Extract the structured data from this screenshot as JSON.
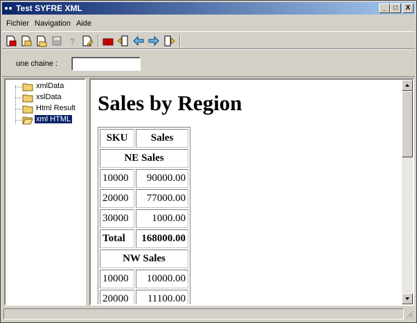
{
  "window": {
    "title": "Test SYFRE XML",
    "controls": {
      "minimize": "_",
      "maximize": "□",
      "close": "X"
    }
  },
  "menu": [
    {
      "label": "Fichier"
    },
    {
      "label": "Navigation"
    },
    {
      "label": "Aide"
    }
  ],
  "toolbar": {
    "buttons": [
      "new-doc-icon",
      "open-doc-icon",
      "open-folder-doc-icon",
      "save-icon",
      "help-icon",
      "edit-doc-icon",
      "books-icon",
      "back-doc-icon",
      "back-arrow-icon",
      "forward-arrow-icon",
      "forward-doc-icon"
    ]
  },
  "input_bar": {
    "label": "une chaine :",
    "value": ""
  },
  "tree": {
    "items": [
      {
        "label": "xmlData",
        "selected": false
      },
      {
        "label": "xslData",
        "selected": false
      },
      {
        "label": "Html Result",
        "selected": false
      },
      {
        "label": "xml HTML",
        "selected": true
      }
    ]
  },
  "report": {
    "title": "Sales by Region",
    "headers": {
      "sku": "SKU",
      "sales": "Sales"
    },
    "groups": [
      {
        "name": "NE Sales",
        "rows": [
          {
            "sku": "10000",
            "sales": "90000.00"
          },
          {
            "sku": "20000",
            "sales": "77000.00"
          },
          {
            "sku": "30000",
            "sales": "1000.00"
          }
        ],
        "total_label": "Total",
        "total": "168000.00"
      },
      {
        "name": "NW Sales",
        "rows": [
          {
            "sku": "10000",
            "sales": "10000.00"
          },
          {
            "sku": "20000",
            "sales": "11100.00"
          }
        ]
      }
    ]
  },
  "colors": {
    "title_bar_start": "#0a246a",
    "title_bar_end": "#a6caf0",
    "selection": "#0a246a",
    "face": "#d4d0c8"
  }
}
